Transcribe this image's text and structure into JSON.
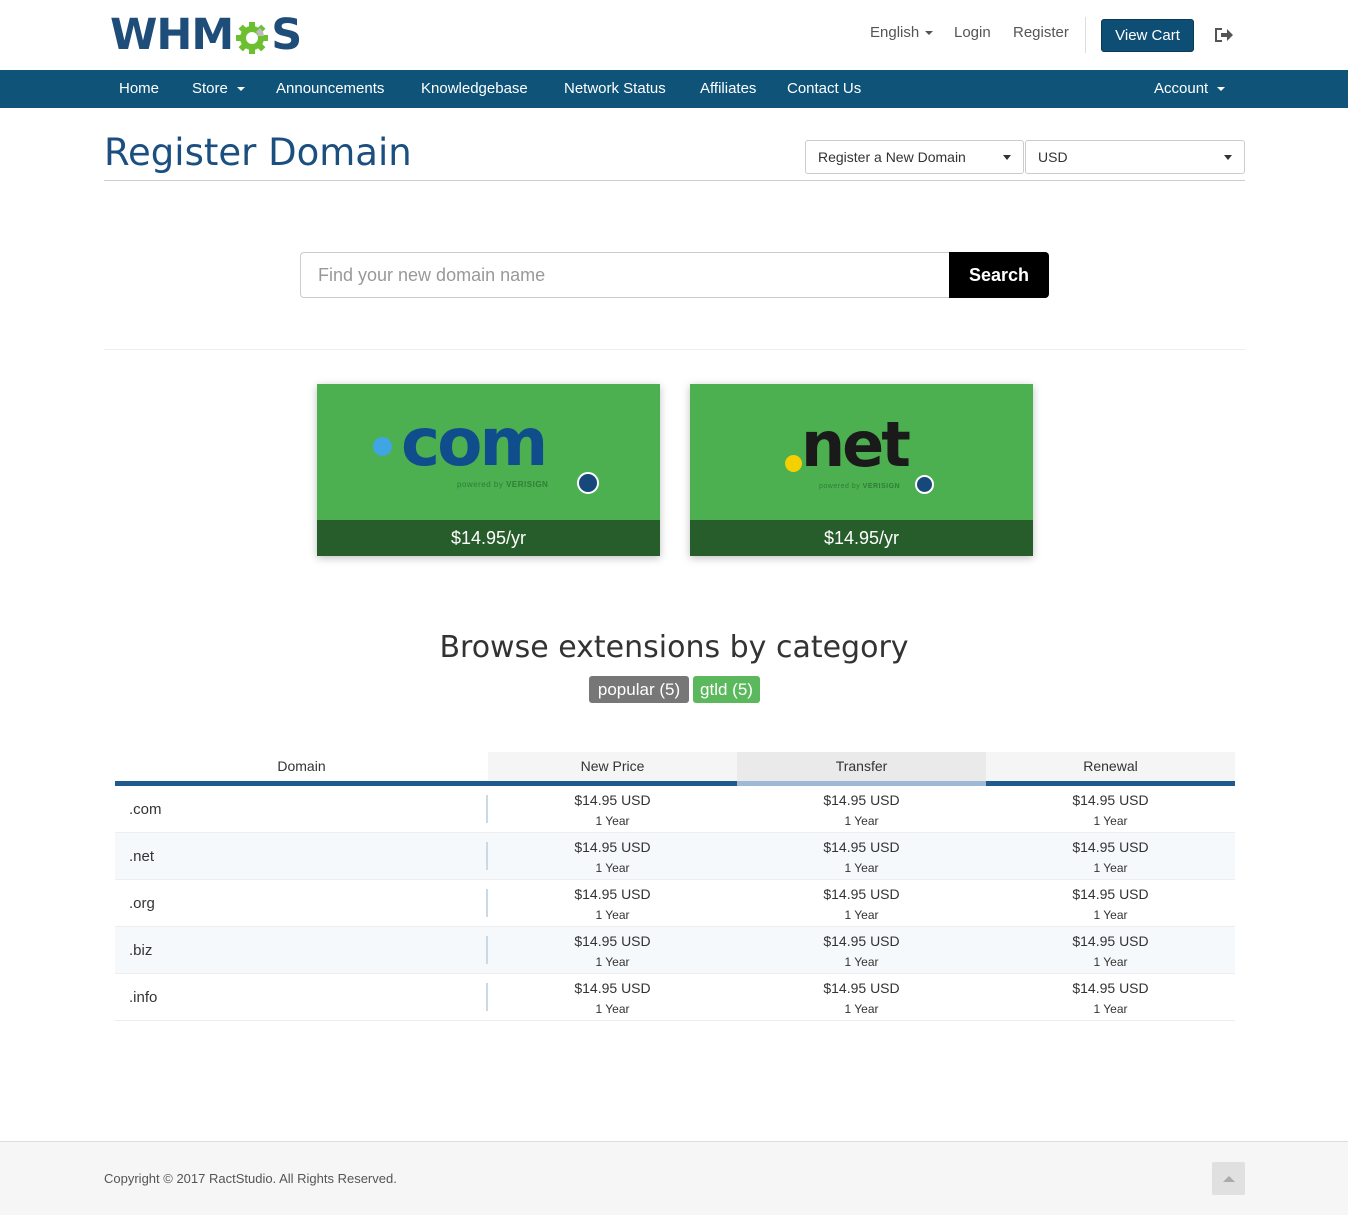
{
  "brand": {
    "logo_text_a": "WHM",
    "logo_text_b": "S"
  },
  "topbar": {
    "language": "English",
    "login": "Login",
    "register": "Register",
    "view_cart": "View Cart",
    "logout_icon": "sign-out-icon"
  },
  "nav": {
    "items": [
      "Home",
      "Store",
      "Announcements",
      "Knowledgebase",
      "Network Status",
      "Affiliates",
      "Contact Us"
    ],
    "account": "Account"
  },
  "page": {
    "title": "Register Domain",
    "domain_action_select": "Register a New Domain",
    "currency_select": "USD"
  },
  "search": {
    "placeholder": "Find your new domain name",
    "button": "Search"
  },
  "featured": [
    {
      "tld": "com",
      "powered_a": "powered by",
      "powered_b": "VERISIGN",
      "price": "$14.95/yr",
      "dot_color": "#3fa6e3",
      "text_color": "#0f4d8c"
    },
    {
      "tld": "net",
      "powered_a": "powered by",
      "powered_b": "VERISIGN",
      "price": "$14.95/yr",
      "dot_color": "#f5d000",
      "text_color": "#1a1a1a"
    }
  ],
  "browse": {
    "title": "Browse extensions by category",
    "categories": [
      {
        "label": "popular (5)",
        "color": "#777777"
      },
      {
        "label": "gtld (5)",
        "color": "#5cb85c"
      }
    ]
  },
  "pricing_table": {
    "headers": [
      "Domain",
      "New Price",
      "Transfer",
      "Renewal"
    ],
    "rows": [
      {
        "tld": ".com",
        "new_price": "$14.95 USD",
        "new_period": "1 Year",
        "transfer": "$14.95 USD",
        "transfer_period": "1 Year",
        "renewal": "$14.95 USD",
        "renewal_period": "1 Year"
      },
      {
        "tld": ".net",
        "new_price": "$14.95 USD",
        "new_period": "1 Year",
        "transfer": "$14.95 USD",
        "transfer_period": "1 Year",
        "renewal": "$14.95 USD",
        "renewal_period": "1 Year"
      },
      {
        "tld": ".org",
        "new_price": "$14.95 USD",
        "new_period": "1 Year",
        "transfer": "$14.95 USD",
        "transfer_period": "1 Year",
        "renewal": "$14.95 USD",
        "renewal_period": "1 Year"
      },
      {
        "tld": ".biz",
        "new_price": "$14.95 USD",
        "new_period": "1 Year",
        "transfer": "$14.95 USD",
        "transfer_period": "1 Year",
        "renewal": "$14.95 USD",
        "renewal_period": "1 Year"
      },
      {
        "tld": ".info",
        "new_price": "$14.95 USD",
        "new_period": "1 Year",
        "transfer": "$14.95 USD",
        "transfer_period": "1 Year",
        "renewal": "$14.95 USD",
        "renewal_period": "1 Year"
      }
    ]
  },
  "footer": {
    "copyright": "Copyright © 2017 RactStudio. All Rights Reserved.",
    "back_to_top_icon": "chevron-up-icon"
  },
  "colors": {
    "primary": "#0f5378",
    "title": "#1b4f7f",
    "card_green": "#4caf50",
    "card_price_bg": "#275c2b"
  }
}
